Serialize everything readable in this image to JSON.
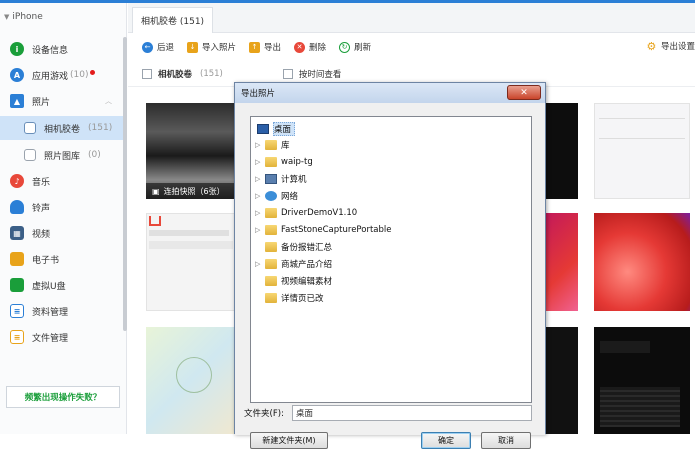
{
  "device": {
    "name": "iPhone"
  },
  "sidebar": {
    "items": [
      {
        "label": "设备信息",
        "count": "",
        "icon": "info-icon",
        "color": "#1a9e3a"
      },
      {
        "label": "应用游戏",
        "count": "(10)",
        "icon": "app-store-icon",
        "color": "#2b7fd6"
      },
      {
        "label": "照片",
        "count": "",
        "icon": "photos-icon",
        "color": "#2b7fd6"
      },
      {
        "label": "相机胶卷",
        "count": "(151)",
        "icon": "camera-roll-icon",
        "color": "#6a8fb9"
      },
      {
        "label": "照片图库",
        "count": "(0)",
        "icon": "photo-library-icon",
        "color": "#9aa3ad"
      },
      {
        "label": "音乐",
        "count": "",
        "icon": "music-icon",
        "color": "#e8483a"
      },
      {
        "label": "铃声",
        "count": "",
        "icon": "bell-icon",
        "color": "#2b7fd6"
      },
      {
        "label": "视频",
        "count": "",
        "icon": "video-icon",
        "color": "#3b5f87"
      },
      {
        "label": "电子书",
        "count": "",
        "icon": "ebook-icon",
        "color": "#e8a31a"
      },
      {
        "label": "虚拟U盘",
        "count": "",
        "icon": "usb-drive-icon",
        "color": "#1a9e3a"
      },
      {
        "label": "资料管理",
        "count": "",
        "icon": "data-manage-icon",
        "color": "#2b7fd6"
      },
      {
        "label": "文件管理",
        "count": "",
        "icon": "file-manage-icon",
        "color": "#e8a31a"
      }
    ],
    "help_label": "频繁出现操作失败？"
  },
  "tab": {
    "label": "相机胶卷 (151)"
  },
  "toolbar": {
    "back": "后退",
    "import": "导入照片",
    "export": "导出",
    "delete": "删除",
    "refresh": "刷新",
    "export_settings": "导出设置"
  },
  "filter": {
    "album": "相机胶卷",
    "count": "(151)",
    "by_time": "按时间查看"
  },
  "thumbs": {
    "burst_label": "连拍快照（6张）"
  },
  "dialog": {
    "title": "导出照片",
    "close_symbol": "✕",
    "tree": [
      {
        "label": "桌面",
        "expandable": false
      },
      {
        "label": "库",
        "expandable": true
      },
      {
        "label": "waip-tg",
        "expandable": true
      },
      {
        "label": "计算机",
        "expandable": true
      },
      {
        "label": "网络",
        "expandable": true
      },
      {
        "label": "DriverDemoV1.10",
        "expandable": true
      },
      {
        "label": "FastStoneCapturePortable",
        "expandable": true
      },
      {
        "label": "备份报错汇总",
        "expandable": false
      },
      {
        "label": "商城产品介绍",
        "expandable": true
      },
      {
        "label": "视频编辑素材",
        "expandable": false
      },
      {
        "label": "详情页已改",
        "expandable": false
      }
    ],
    "folder_label": "文件夹(F):",
    "folder_value": "桌面",
    "new_folder": "新建文件夹(M)",
    "ok": "确定",
    "cancel": "取消"
  }
}
